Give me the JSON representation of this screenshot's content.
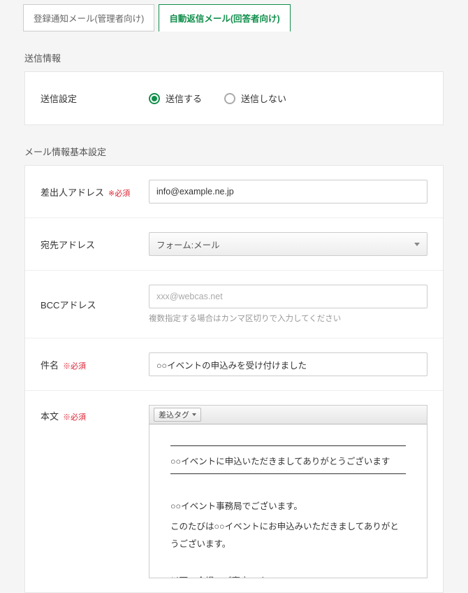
{
  "tabs": {
    "admin": "登録通知メール(管理者向け)",
    "auto": "自動返信メール(回答者向け)"
  },
  "sections": {
    "send_info": "送信情報",
    "mail_basic": "メール情報基本設定"
  },
  "labels": {
    "send_setting": "送信設定",
    "from": "差出人アドレス",
    "to": "宛先アドレス",
    "bcc": "BCCアドレス",
    "subject": "件名",
    "body": "本文",
    "required": "※必須"
  },
  "radio": {
    "send_yes": "送信する",
    "send_no": "送信しない",
    "selected": "yes"
  },
  "fields": {
    "from_value": "info@example.ne.jp",
    "to_select_value": "フォーム:メール",
    "bcc_placeholder": "xxx@webcas.net",
    "bcc_hint": "複数指定する場合はカンマ区切りで入力してください",
    "subject_value": "○○イベントの申込みを受け付けました"
  },
  "editor": {
    "toolbar_button": "差込タグ",
    "line1": "○○イベントに申込いただきましてありがとうございます",
    "p1": "○○イベント事務局でございます。",
    "p2": "このたびは○○イベントにお申込みいただきましてありがとうございます。",
    "p3": "以下、会場のご案内です。"
  }
}
